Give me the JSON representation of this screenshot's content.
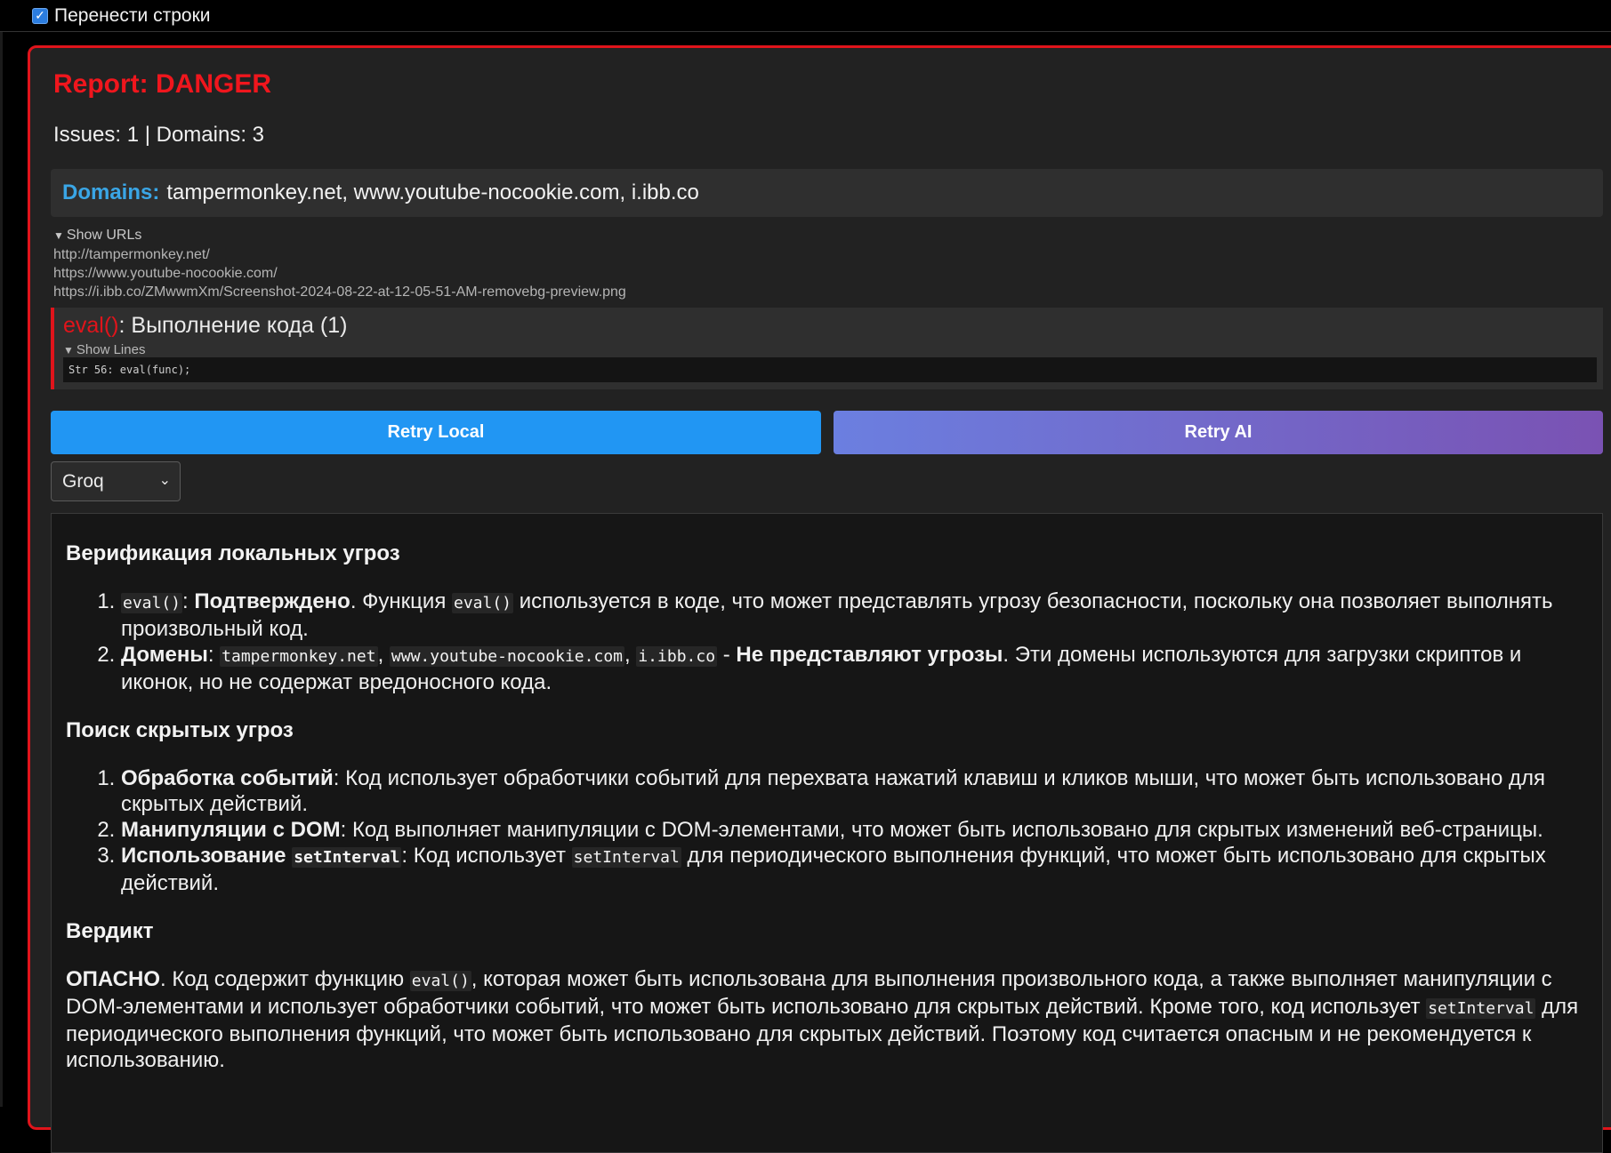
{
  "toolbar": {
    "wrap_label": "Перенести строки",
    "wrap_checked": true
  },
  "report": {
    "title": "Report: DANGER",
    "stats": "Issues: 1 | Domains: 3",
    "domains_label": "Domains:",
    "domains_value": "tampermonkey.net, www.youtube-nocookie.com, i.ibb.co",
    "urls_summary": "Show URLs",
    "urls": [
      "http://tampermonkey.net/",
      "https://www.youtube-nocookie.com/",
      "https://i.ibb.co/ZMwwmXm/Screenshot-2024-08-22-at-12-05-51-AM-removebg-preview.png"
    ],
    "issue": {
      "fn": "eval()",
      "title": ": Выполнение кода (1)",
      "lines_summary": "Show Lines",
      "code_line": "Str 56: eval(func);"
    },
    "retry_local": "Retry Local",
    "retry_ai": "Retry AI",
    "provider": "Groq"
  },
  "analysis": {
    "h1": "Верификация локальных угроз",
    "l1_1": {
      "code1": "eval()",
      "sep": ": ",
      "bold": "Подтверждено",
      "t1": ". Функция ",
      "code2": "eval()",
      "t2": " используется в коде, что может представлять угрозу безопасности, поскольку она позволяет выполнять произвольный код."
    },
    "l1_2": {
      "bold": "Домены",
      "sep": ": ",
      "c1": "tampermonkey.net",
      "comma1": ", ",
      "c2": "www.youtube-nocookie.com",
      "comma2": ", ",
      "c3": "i.ibb.co",
      "dash": " - ",
      "bold2": "Не представляют угрозы",
      "t": ". Эти домены используются для загрузки скриптов и иконок, но не содержат вредоносного кода."
    },
    "h2": "Поиск скрытых угроз",
    "l2_1": {
      "bold": "Обработка событий",
      "t": ": Код использует обработчики событий для перехвата нажатий клавиш и кликов мыши, что может быть использовано для скрытых действий."
    },
    "l2_2": {
      "bold": "Манипуляции с DOM",
      "t": ": Код выполняет манипуляции с DOM-элементами, что может быть использовано для скрытых изменений веб-страницы."
    },
    "l2_3": {
      "bold": "Использование ",
      "bcode": "setInterval",
      "t1": ": Код использует ",
      "code": "setInterval",
      "t2": " для периодического выполнения функций, что может быть использовано для скрытых действий."
    },
    "h3": "Вердикт",
    "verdict": {
      "bold": "ОПАСНО",
      "t1": ". Код содержит функцию ",
      "code1": "eval()",
      "t2": ", которая может быть использована для выполнения произвольного кода, а также выполняет манипуляции с DOM-элементами и использует обработчики событий, что может быть использовано для скрытых действий. Кроме того, код использует ",
      "code2": "setInterval",
      "t3": " для периодического выполнения функций, что может быть использовано для скрытых действий. Поэтому код считается опасным и не рекомендуется к использованию."
    }
  }
}
